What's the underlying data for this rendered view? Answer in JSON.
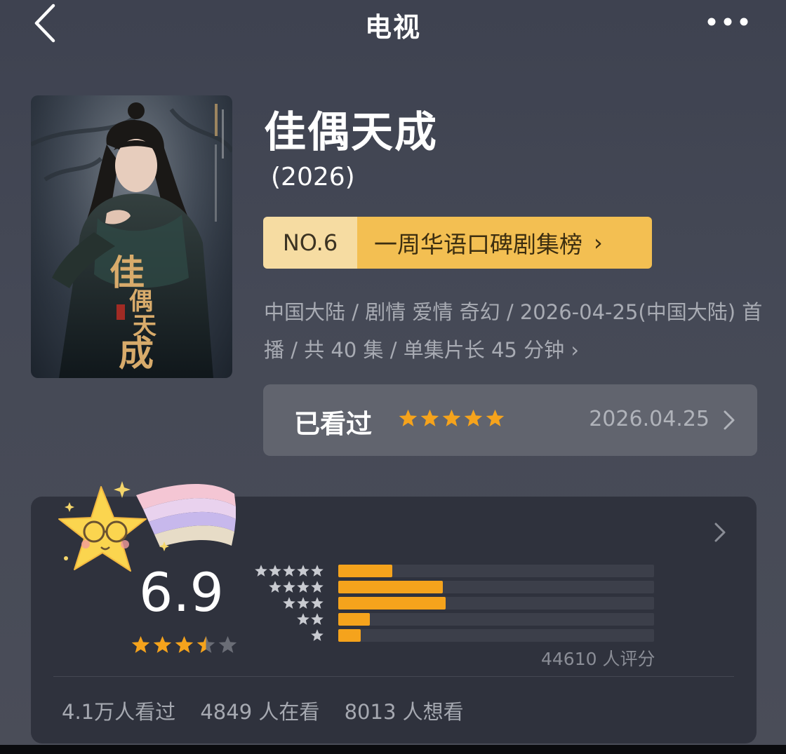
{
  "header": {
    "title": "电视",
    "back_icon": "chevron-left-icon",
    "more_icon": "more-horizontal-icon"
  },
  "drama": {
    "title": "佳偶天成",
    "year": "(2026)",
    "poster_title": "佳偶天成",
    "ranking": {
      "number": "NO.6",
      "label": "一周华语口碑剧集榜",
      "chevron": "›"
    },
    "meta_line": "中国大陆 / 剧情 爱情 奇幻 / 2026-04-25(中国大陆) 首播 / 共 40 集 / 单集片长 45 分钟",
    "meta_chevron": "›"
  },
  "watched": {
    "label": "已看过",
    "user_rating_stars": 5,
    "date": "2026.04.25"
  },
  "rating": {
    "score": "6.9",
    "score_stars": 3.5,
    "count_text": "44610 人评分",
    "distribution": [
      {
        "stars": 5,
        "fraction": 0.17
      },
      {
        "stars": 4,
        "fraction": 0.33
      },
      {
        "stars": 3,
        "fraction": 0.34
      },
      {
        "stars": 2,
        "fraction": 0.1
      },
      {
        "stars": 1,
        "fraction": 0.07
      }
    ],
    "stats": {
      "watched": "4.1万人看过",
      "watching": "4849 人在看",
      "want": "8013 人想看"
    }
  },
  "colors": {
    "background": "#454956",
    "accent_star": "#f5a31c",
    "rank_badge_light": "#f6dca2",
    "rank_badge_dark": "#f3bf52",
    "card": "#2f323d",
    "watched_card": "#61646e"
  }
}
